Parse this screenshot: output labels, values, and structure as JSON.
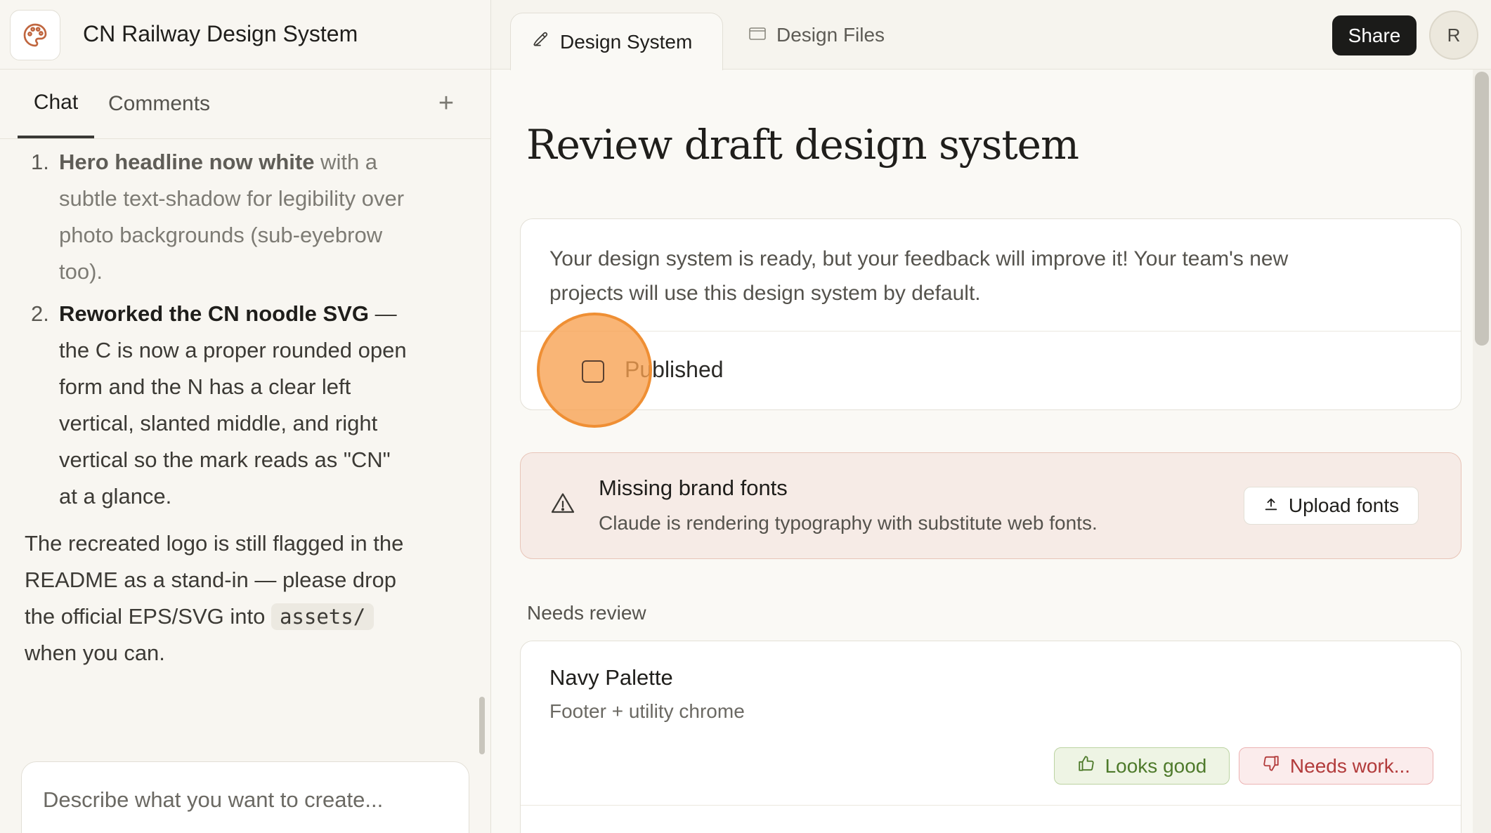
{
  "app": {
    "project_title": "CN Railway Design System",
    "logo_icon": "palette-icon"
  },
  "left_tabs": {
    "chat": "Chat",
    "comments": "Comments",
    "add": "+"
  },
  "chat": {
    "item1": {
      "num": "1.",
      "bold": "Hero headline now white",
      "rest_inline": " with a",
      "lines": [
        "subtle text-shadow for legibility over",
        "photo backgrounds (sub-eyebrow",
        "too)."
      ]
    },
    "item2": {
      "num": "2.",
      "bold": "Reworked the CN noodle SVG",
      "rest_inline": " —",
      "lines": [
        "the C is now a proper rounded open",
        "form and the N has a clear left",
        "vertical, slanted middle, and right",
        "vertical so the mark reads as \"CN\"",
        "at a glance."
      ]
    },
    "para": {
      "line1": "The recreated logo is still flagged in the",
      "line2": "README as a stand-in — please drop",
      "line3_pre": "the official EPS/SVG into ",
      "code": "assets/",
      "line4": "when you can."
    },
    "prompt_placeholder": "Describe what you want to create..."
  },
  "topbar": {
    "tab_active": "Design System",
    "tab_active_icon": "pen-icon",
    "tab_other": "Design Files",
    "tab_other_icon": "folder-icon",
    "share": "Share",
    "avatar_initial": "R"
  },
  "main": {
    "title": "Review draft design system",
    "publish_card": {
      "desc_line1": "Your design system is ready, but your feedback will improve it! Your team's new",
      "desc_line2": "projects will use this design system by default.",
      "checkbox_label": "Published",
      "checked": false
    },
    "alert": {
      "icon": "warning-icon",
      "title": "Missing brand fonts",
      "subtitle": "Claude is rendering typography with substitute web fonts.",
      "button": "Upload fonts"
    },
    "section_label": "Needs review",
    "review_item": {
      "title": "Navy Palette",
      "subtitle": "Footer + utility chrome",
      "good": "Looks good",
      "bad": "Needs work..."
    }
  },
  "colors": {
    "accent_orange": "#ef8f34",
    "alert_bg": "#f6ebe6",
    "good_green": "#4e7a2b",
    "bad_red": "#b23b3b",
    "share_bg": "#1b1b19"
  }
}
